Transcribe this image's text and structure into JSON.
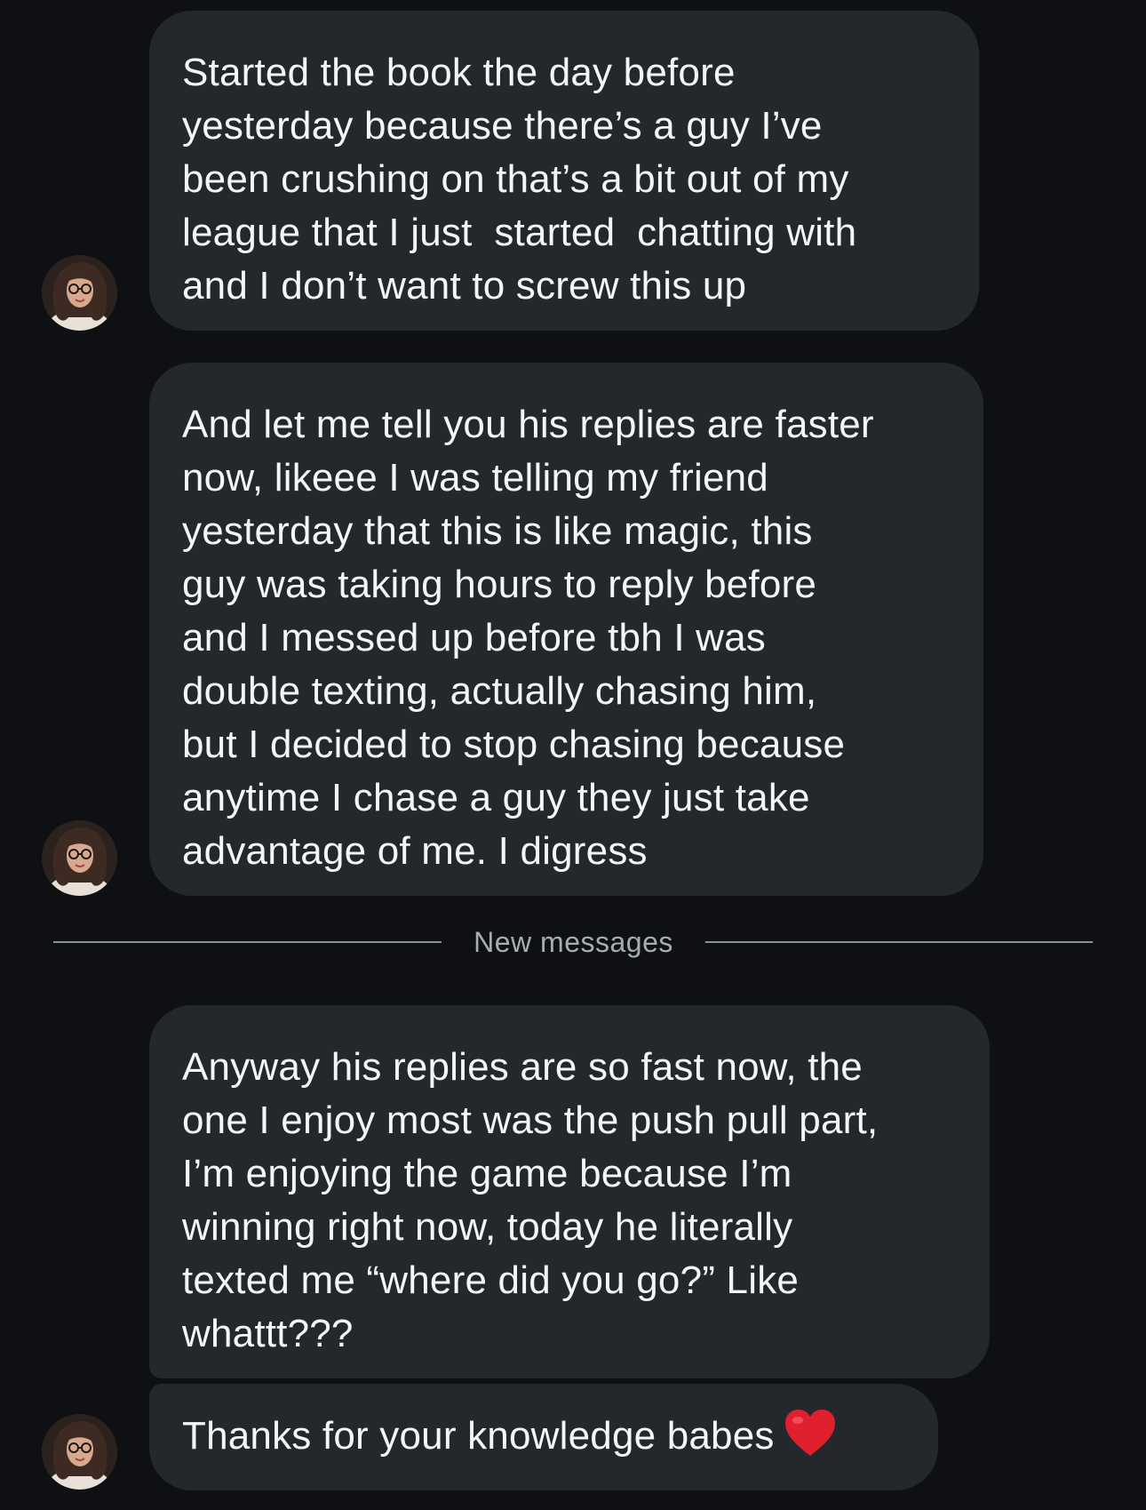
{
  "conversation": {
    "messages": [
      {
        "text": "Started the book the day before\nyesterday because there’s a guy I’ve\nbeen crushing on that’s a bit out of my\nleague that I just  started  chatting with\nand I don’t want to screw this up"
      },
      {
        "text": "And let me tell you his replies are faster\nnow, likeee I was telling my friend\nyesterday that this is like magic, this\nguy was taking hours to reply before\nand I messed up before tbh I was\ndouble texting, actually chasing him,\nbut I decided to stop chasing because\nanytime I chase a guy they just take\nadvantage of me. I digress"
      },
      {
        "text": "Anyway his replies are so fast now, the\none I enjoy most was the push pull part,\nI’m enjoying the game because I’m\nwinning right now, today he literally\ntexted me “where did you go?” Like\nwhattt???"
      },
      {
        "text": "Thanks for your knowledge babes",
        "emoji": "red-heart"
      }
    ],
    "divider_label": "New messages"
  },
  "colors": {
    "background": "#0e1014",
    "bubble": "#24272c",
    "text": "#f4f5f7",
    "divider": "#8b9098",
    "heart": "#e0202f"
  }
}
